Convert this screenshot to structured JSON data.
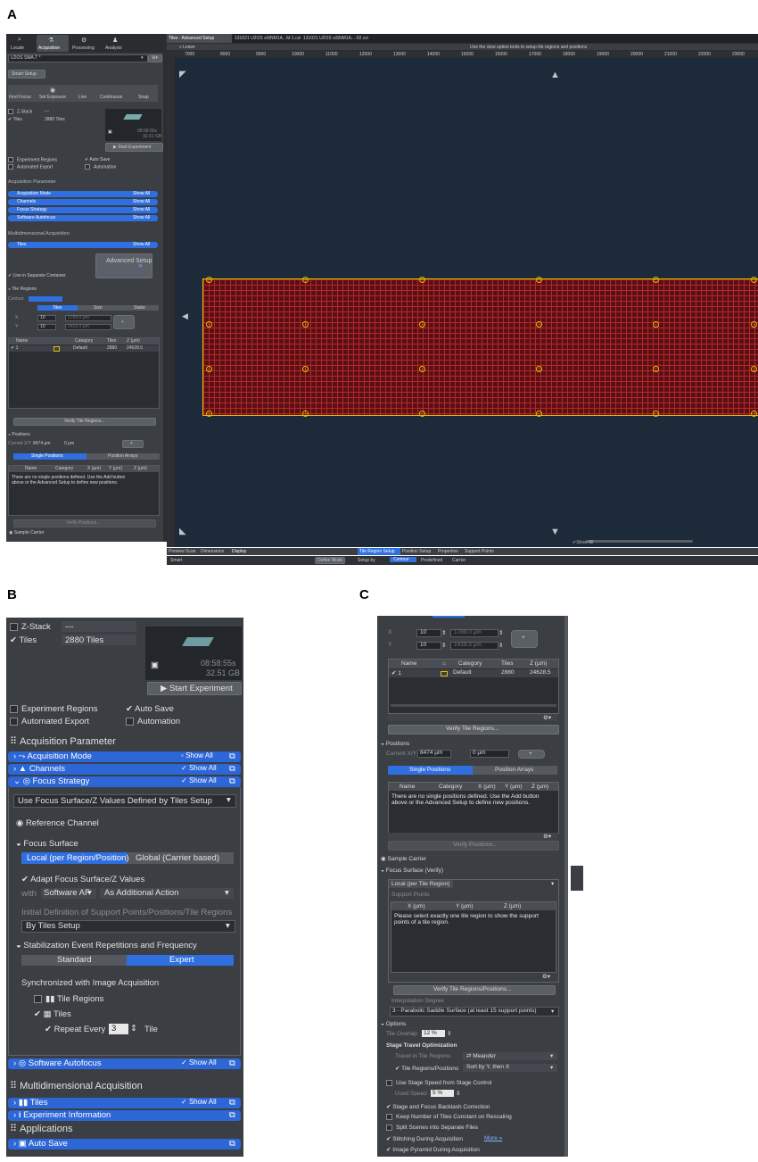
{
  "panel_labels": {
    "a": "A",
    "b": "B",
    "c": "C"
  },
  "colors": {
    "accent": "#2f6fe0",
    "grid": "#8b1a1a",
    "marker": "#e6c000",
    "canvas": "#1c2a3a",
    "panel": "#3b3e43"
  },
  "a": {
    "top_tabs": [
      {
        "label": "Locate",
        "icon": "locate-icon"
      },
      {
        "label": "Acquisition",
        "icon": "microscope-icon"
      },
      {
        "label": "Processing",
        "icon": "gear-icon"
      },
      {
        "label": "Analysis",
        "icon": "person-icon"
      }
    ],
    "experiment_name": "U2OS SMA.T *",
    "smart_setup": "Smart Setup",
    "tools": [
      "Find Focus",
      "Set Exposure",
      "Live",
      "Continuous",
      "Snap"
    ],
    "zstack": "Z-Stack",
    "zstack_value": "---",
    "tiles": "Tiles",
    "tiles_value": "2880 Tiles",
    "time_value": "08:58:55s",
    "size_value": "32.51 GB",
    "start_experiment": "Start Experiment",
    "experiment_regions": "Experiment Regions",
    "auto_save": "Auto Save",
    "automated_export": "Automated Export",
    "automation": "Automation",
    "acq_param": "Acquisition Parameter",
    "acq_bars": [
      "Acquisition Mode",
      "Channels",
      "Focus Strategy",
      "Software Autofocus"
    ],
    "show_all": "Show All",
    "multidim": "Multidimensional Acquisition",
    "tiles_bar": "Tiles",
    "advanced_setup": "Advanced Setup",
    "live_separate": "Live in Separate Container",
    "tile_regions": "Tile Regions",
    "contour": "Contour",
    "seg_tiles": "Tiles",
    "seg_size": "Size",
    "seg_stake": "Stake",
    "x_label": "X",
    "y_label": "Y",
    "x_value": "10",
    "y_value": "10",
    "x_um": "1789.0 µm",
    "y_um": "1419.3 µm",
    "table_headers": [
      "Name",
      "Category",
      "Tiles",
      "Z (µm)"
    ],
    "table_row": [
      "1",
      "Default",
      "2880",
      "24628.5"
    ],
    "verify_tiles": "Verify Tile Regions...",
    "positions": "Positions",
    "current_xy": "Current X/Y",
    "cx": "8474 µm",
    "cy": "0 µm",
    "single_positions": "Single Positions",
    "position_arrays": "Position Arrays",
    "pos_headers": [
      "Name",
      "Category",
      "X (µm)",
      "Y (µm)",
      "Z (µm)"
    ],
    "pos_empty": "There are no single positions defined. Use the Add button above or the Advanced Setup to define new positions.",
    "verify_positions": "Verify Positions...",
    "sample_carrier": "Sample Carrier",
    "focus_surface": "Focus Surface (Verify)",
    "options": "Options",
    "doc_tabs": [
      "Tiles - Advanced Setup",
      "131021 U2OS siSNM1A...M-1.czi",
      "131021 U2OS siSNM1A...-02.czi"
    ],
    "ruler_ticks": [
      "7000",
      "8000",
      "9000",
      "10000",
      "11000",
      "12000",
      "13000",
      "14000",
      "15000",
      "16000",
      "17000",
      "18000",
      "19000",
      "20000",
      "21000",
      "22000",
      "23000"
    ],
    "leave": "Leave",
    "hint": "Use the view option tools to setup tile regions and positions",
    "bottom_tabs_left": [
      "Preview Scan",
      "Dimensions",
      "Display"
    ],
    "bottom_tabs_right": [
      "Tile Region Setup",
      "Position Setup",
      "Properties",
      "Support Points"
    ],
    "bottom_row": [
      "Smart",
      "Define Mode",
      "Setup by",
      "Contour",
      "Predefined",
      "Carrier"
    ],
    "show_all_small": "Show All"
  },
  "b": {
    "zstack": "Z-Stack",
    "zstack_value": "---",
    "tiles": "Tiles",
    "tiles_value": "2880 Tiles",
    "time_value": "08:58:55s",
    "size_value": "32.51 GB",
    "start_experiment": "Start Experiment",
    "experiment_regions": "Experiment Regions",
    "auto_save": "Auto Save",
    "automated_export": "Automated Export",
    "automation": "Automation",
    "acq_param": "Acquisition Parameter",
    "acq_mode": "Acquisition Mode",
    "channels": "Channels",
    "focus_strategy": "Focus Strategy",
    "show_all": "Show All",
    "use_focus": "Use Focus Surface/Z Values Defined by Tiles Setup",
    "reference_channel": "Reference Channel",
    "focus_surface": "Focus Surface",
    "local": "Local (per Region/Position)",
    "global": "Global (Carrier based)",
    "adapt": "Adapt Focus Surface/Z Values",
    "with": "with",
    "software_af": "Software AF",
    "as_additional": "As Additional Action",
    "initial_def": "Initial Definition of Support Points/Positions/Tile Regions",
    "by_tiles": "By Tiles Setup",
    "stabilization": "Stabilization Event Repetitions and Frequency",
    "standard": "Standard",
    "expert": "Expert",
    "synchronized": "Synchronized with Image Acquisition",
    "tile_regions": "Tile Regions",
    "tiles_cb": "Tiles",
    "repeat_every": "Repeat Every",
    "repeat_value": "3",
    "tile_word": "Tile",
    "software_autofocus": "Software Autofocus",
    "multidim": "Multidimensional Acquisition",
    "tiles_bar": "Tiles",
    "experiment_info": "Experiment Information",
    "applications": "Applications",
    "auto_save_bar": "Auto Save"
  },
  "c": {
    "x_label": "X",
    "y_label": "Y",
    "x_value": "10",
    "y_value": "10",
    "x_um": "1789.0 µm",
    "y_um": "1419.3 µm",
    "table_headers": [
      "Name",
      "Category",
      "Tiles",
      "Z (µm)"
    ],
    "table_row": [
      "1",
      "Default",
      "2880",
      "24628.5"
    ],
    "verify_tiles": "Verify Tile Regions...",
    "positions": "Positions",
    "current_xy": "Current X/Y",
    "cx": "8474 µm",
    "cy": "0 µm",
    "single_positions": "Single Positions",
    "position_arrays": "Position Arrays",
    "pos_headers": [
      "Name",
      "Category",
      "X (µm)",
      "Y (µm)",
      "Z (µm)"
    ],
    "pos_empty": "There are no single positions defined. Use the Add button above or the Advanced Setup to define new positions.",
    "verify_positions": "Verify Positions...",
    "sample_carrier": "Sample Carrier",
    "focus_surface": "Focus Surface (Verify)",
    "local_tab": "Local (per Tile Region)",
    "support_points": "Support Points",
    "sp_headers": [
      "X (µm)",
      "Y (µm)",
      "Z (µm)"
    ],
    "sp_empty": "Please select exactly one tile region to show the support points of a tile region.",
    "verify_tr_pos": "Verify Tile Regions/Positions...",
    "interp_degree": "Interpolation Degree",
    "interp_value": "3 - Parabolic Saddle Surface (at least 15 support points)",
    "options": "Options",
    "tile_overlap": "Tile Overlap",
    "tile_overlap_value": "12 %",
    "stage_travel": "Stage Travel Optimization",
    "travel_in": "Travel in Tile Regions",
    "meander": "Meander",
    "tr_positions": "Tile Regions/Positions",
    "sort_by": "Sort by Y, then X",
    "use_stage_speed": "Use Stage Speed from Stage Control",
    "used_speed": "Used Speed",
    "used_speed_value": "5 %",
    "backlash": "Stage and Focus Backlash Correction",
    "keep_number": "Keep Number of Tiles Constant on Rescaling",
    "split_scenes": "Split Scenes into Separate Files",
    "stitching": "Stitching During Acquisition",
    "more": "More »",
    "pyramid": "Image Pyramid During Acquisition"
  }
}
